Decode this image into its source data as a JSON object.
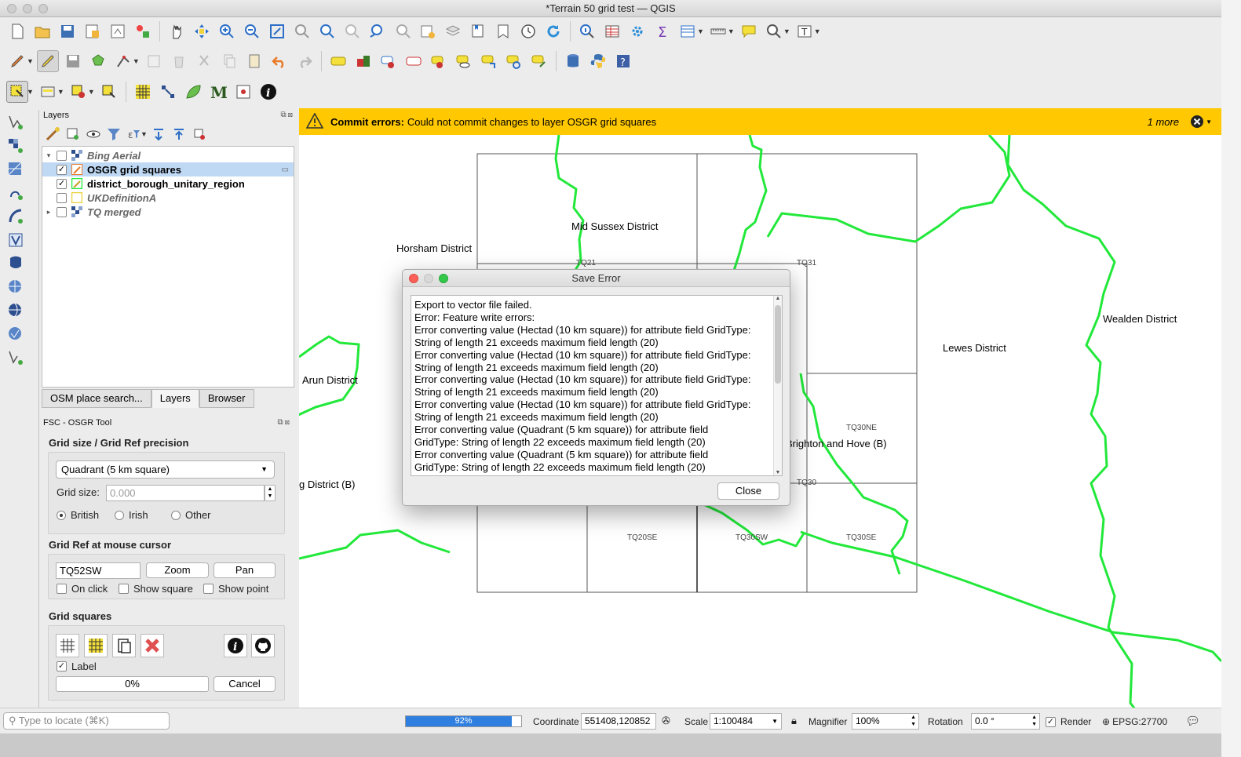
{
  "window": {
    "title": "*Terrain 50 grid test — QGIS"
  },
  "panel": {
    "layers_title": "Layers",
    "layers": [
      {
        "name": "Bing Aerial",
        "checked": "",
        "style": "ital",
        "expand": "▾",
        "icon": "raster"
      },
      {
        "name": "OSGR grid squares",
        "checked": "✓",
        "style": "bold",
        "expand": "",
        "icon": "edit"
      },
      {
        "name": "district_borough_unitary_region",
        "checked": "✓",
        "style": "bold",
        "expand": "",
        "icon": "poly"
      },
      {
        "name": "UKDefinitionA",
        "checked": "",
        "style": "ital",
        "expand": "",
        "icon": "empty"
      },
      {
        "name": "TQ merged",
        "checked": "",
        "style": "ital",
        "expand": "▸",
        "icon": "raster"
      }
    ],
    "tabs": [
      "OSM place search...",
      "Layers",
      "Browser"
    ],
    "active_tab": "Layers",
    "tool_title": "FSC - OSGR Tool",
    "grid_group": "Grid size / Grid Ref precision",
    "grid_select": "Quadrant (5 km square)",
    "grid_size_label": "Grid size:",
    "grid_size_placeholder": "0.000",
    "radios": [
      "British",
      "Irish",
      "Other"
    ],
    "radio_selected": "British",
    "gridref_group": "Grid Ref at mouse cursor",
    "gridref_value": "TQ52SW",
    "zoom_btn": "Zoom",
    "pan_btn": "Pan",
    "checks": [
      "On click",
      "Show square",
      "Show point"
    ],
    "squares_group": "Grid squares",
    "label_check": "Label",
    "progress": "0%",
    "cancel_btn": "Cancel"
  },
  "msgbar": {
    "title": "Commit errors:",
    "text": "Could not commit changes to layer OSGR grid squares",
    "more": "1 more"
  },
  "map": {
    "districts": [
      "Mid Sussex District",
      "Horsham District",
      "Arun District",
      "Lewes District",
      "Wealden District",
      "Brighton and Hove (B)",
      "g District (B)"
    ],
    "grid_labels": [
      "TQ21",
      "TQ31",
      "TQ30NE",
      "TQ30",
      "TQ20SE",
      "TQ30SW",
      "TQ30SE"
    ]
  },
  "dialog": {
    "title": "Save Error",
    "lines": [
      "Export to vector file failed.",
      "Error: Feature write errors:",
      "Error converting value (Hectad (10 km square)) for attribute field GridType:",
      "String of length 21 exceeds maximum field length (20)",
      "Error converting value (Hectad (10 km square)) for attribute field GridType:",
      "String of length 21 exceeds maximum field length (20)",
      "Error converting value (Hectad (10 km square)) for attribute field GridType:",
      "String of length 21 exceeds maximum field length (20)",
      "Error converting value (Hectad (10 km square)) for attribute field GridType:",
      "String of length 21 exceeds maximum field length (20)",
      "Error converting value (Quadrant (5 km square)) for attribute field",
      "GridType: String of length 22 exceeds maximum field length (20)",
      "Error converting value (Quadrant (5 km square)) for attribute field",
      "GridType: String of length 22 exceeds maximum field length (20)"
    ],
    "close": "Close"
  },
  "status": {
    "locate_placeholder": "Type to locate (⌘K)",
    "progress": "92%",
    "progress_value": 0.92,
    "coordinate_label": "Coordinate",
    "coordinate": "551408,120852",
    "scale_label": "Scale",
    "scale": "1:100484",
    "magnifier_label": "Magnifier",
    "magnifier": "100%",
    "rotation_label": "Rotation",
    "rotation": "0.0 °",
    "render_label": "Render",
    "crs": "EPSG:27700"
  },
  "colors": {
    "accent": "#ffc800",
    "boundary": "#22e83a",
    "progress": "#2f7fe0"
  }
}
